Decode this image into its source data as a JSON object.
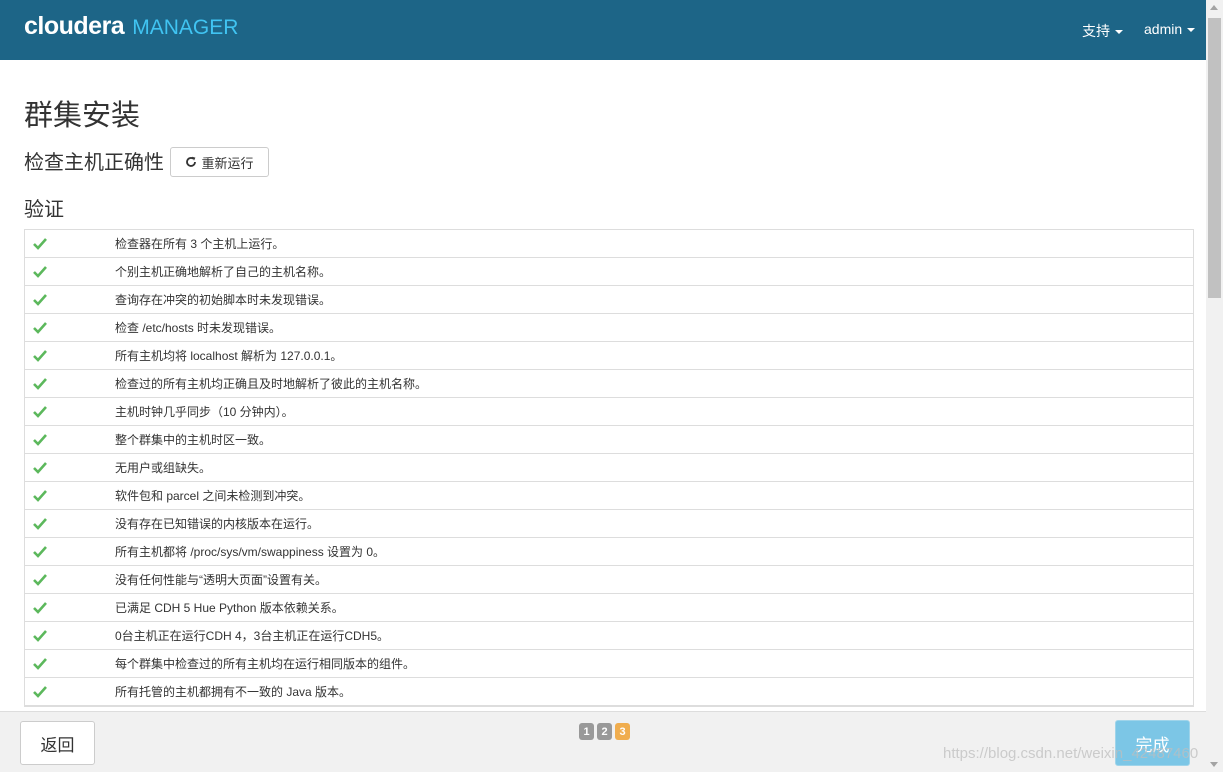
{
  "header": {
    "brand_cloudera": "cloudera",
    "brand_manager": "MANAGER",
    "menus": [
      {
        "label": "支持"
      },
      {
        "label": "admin"
      }
    ],
    "background_color": "#1d6587",
    "brand_accent_color": "#40c4f2"
  },
  "page": {
    "title": "群集安装",
    "section_title": "检查主机正确性",
    "rerun_button": "重新运行",
    "subsection_title": "验证"
  },
  "checks": [
    {
      "icon": "check-icon",
      "text": "检查器在所有 3 个主机上运行。"
    },
    {
      "icon": "check-icon",
      "text": "个别主机正确地解析了自己的主机名称。"
    },
    {
      "icon": "check-icon",
      "text": "查询存在冲突的初始脚本时未发现错误。"
    },
    {
      "icon": "check-icon",
      "text": "检查 /etc/hosts 时未发现错误。"
    },
    {
      "icon": "check-icon",
      "text": "所有主机均将 localhost 解析为 127.0.0.1。"
    },
    {
      "icon": "check-icon",
      "text": "检查过的所有主机均正确且及时地解析了彼此的主机名称。"
    },
    {
      "icon": "check-icon",
      "text": "主机时钟几乎同步（10 分钟内）。"
    },
    {
      "icon": "check-icon",
      "text": "整个群集中的主机时区一致。"
    },
    {
      "icon": "check-icon",
      "text": "无用户或组缺失。"
    },
    {
      "icon": "check-icon",
      "text": "软件包和 parcel 之间未检测到冲突。"
    },
    {
      "icon": "check-icon",
      "text": "没有存在已知错误的内核版本在运行。"
    },
    {
      "icon": "check-icon",
      "text": "所有主机都将 /proc/sys/vm/swappiness 设置为 0。"
    },
    {
      "icon": "check-icon",
      "text": "没有任何性能与“透明大页面”设置有关。"
    },
    {
      "icon": "check-icon",
      "text": "已满足 CDH 5 Hue Python 版本依赖关系。"
    },
    {
      "icon": "check-icon",
      "text": "0台主机正在运行CDH 4，3台主机正在运行CDH5。"
    },
    {
      "icon": "check-icon",
      "text": "每个群集中检查过的所有主机均在运行相同版本的组件。"
    },
    {
      "icon": "check-icon",
      "text": "所有托管的主机都拥有不一致的 Java 版本。"
    }
  ],
  "check_color": "#5cb85c",
  "footer": {
    "back_button": "返回",
    "finish_button": "完成",
    "pages": [
      "1",
      "2",
      "3"
    ],
    "current_page": "3",
    "watermark": "https://blog.csdn.net/weixin_42487460"
  }
}
